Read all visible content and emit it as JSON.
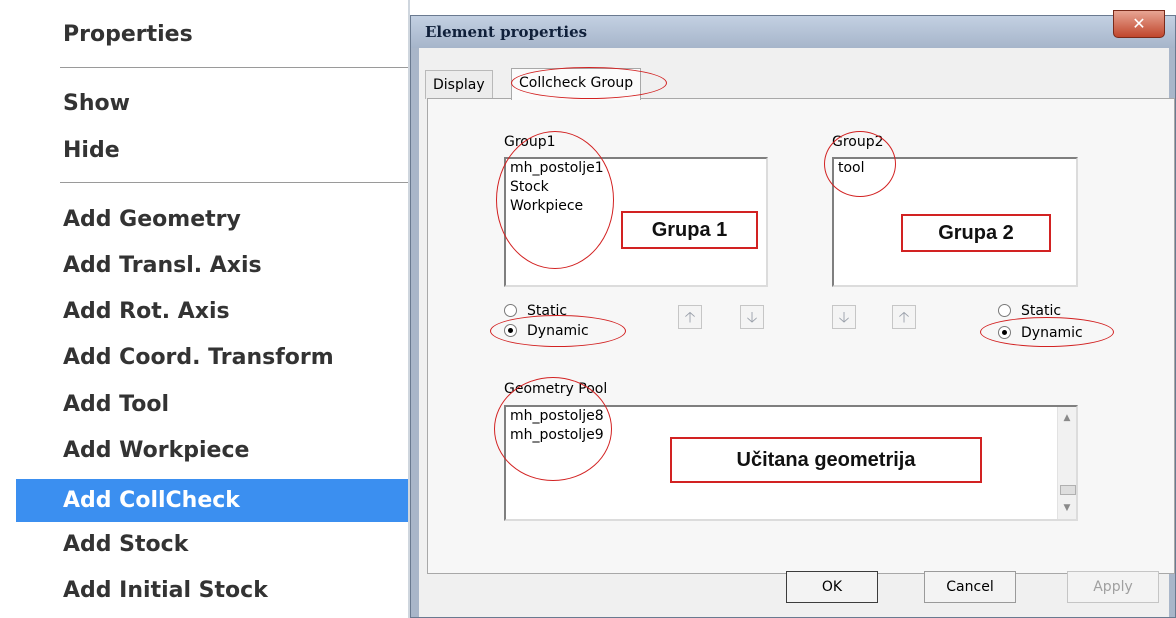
{
  "menu": {
    "items": [
      {
        "label": "Properties"
      },
      {
        "label": "Show"
      },
      {
        "label": "Hide"
      },
      {
        "label": "Add Geometry"
      },
      {
        "label": "Add Transl. Axis"
      },
      {
        "label": "Add Rot. Axis"
      },
      {
        "label": "Add Coord. Transform"
      },
      {
        "label": "Add Tool"
      },
      {
        "label": "Add Workpiece"
      },
      {
        "label": "Add CollCheck"
      },
      {
        "label": "Add Stock"
      },
      {
        "label": "Add Initial Stock"
      }
    ],
    "highlighted": "Add CollCheck",
    "highlight_color": "#3b8ff0"
  },
  "dialog": {
    "title": "Element properties",
    "close_icon": "close-x-icon",
    "tabs": [
      {
        "label": "Display"
      },
      {
        "label": "Collcheck Group"
      }
    ],
    "active_tab": "Collcheck Group",
    "group1": {
      "label": "Group1",
      "items": [
        "mh_postolje1",
        "Stock",
        "Workpiece"
      ],
      "annotation": "Grupa 1",
      "radio": {
        "static": "Static",
        "dynamic": "Dynamic",
        "selected": "Dynamic"
      }
    },
    "group2": {
      "label": "Group2",
      "items": [
        "tool"
      ],
      "annotation": "Grupa 2",
      "radio": {
        "static": "Static",
        "dynamic": "Dynamic",
        "selected": "Dynamic"
      }
    },
    "transfer_icons": [
      "arrow-up-icon",
      "arrow-down-icon",
      "arrow-down-icon",
      "arrow-up-icon"
    ],
    "pool": {
      "label": "Geometry Pool",
      "items": [
        "mh_postolje8",
        "mh_postolje9"
      ],
      "annotation": "Učitana geometrija"
    },
    "buttons": {
      "ok": "OK",
      "cancel": "Cancel",
      "apply": "Apply"
    },
    "annotation_color": "#d22222"
  }
}
